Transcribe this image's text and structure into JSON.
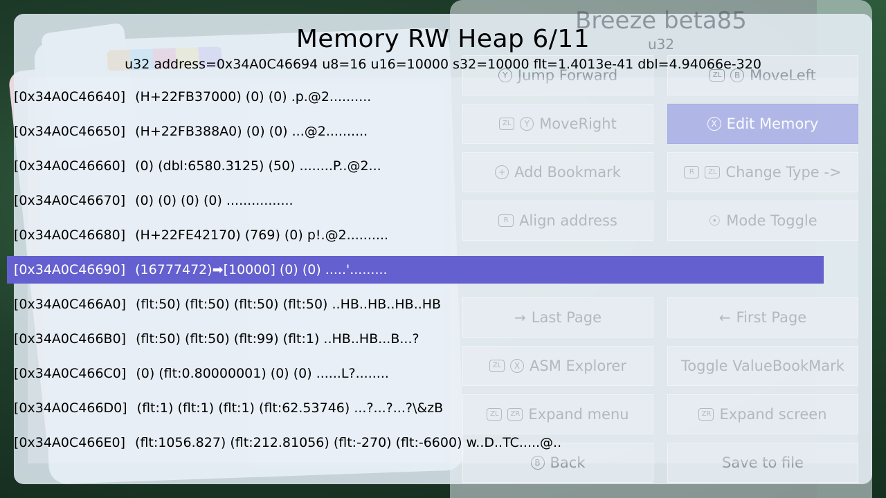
{
  "header": {
    "title": "Memory RW Heap 6/11",
    "subtitle": "u32 address=0x34A0C46694 u8=16 u16=10000 s32=10000 flt=1.4013e-41 dbl=4.94066e-320"
  },
  "menu": {
    "title": "Breeze beta85",
    "subtitle": "u32",
    "buttons": [
      {
        "label": "Jump Forward",
        "icons": [
          "Y"
        ],
        "active": false
      },
      {
        "label": "MoveLeft",
        "icons": [
          "ZL",
          "B"
        ],
        "active": false
      },
      {
        "label": "MoveRight",
        "icons": [
          "ZL",
          "Y"
        ],
        "active": false
      },
      {
        "label": "Edit Memory",
        "icons": [
          "X"
        ],
        "active": true
      },
      {
        "label": "Add Bookmark",
        "icons": [
          "+"
        ],
        "active": false
      },
      {
        "label": "Change Type ->",
        "icons": [
          "R",
          "ZL"
        ],
        "active": false
      },
      {
        "label": "Align address",
        "icons": [
          "R"
        ],
        "active": false
      },
      {
        "label": "Mode Toggle",
        "icons": [
          "stick"
        ],
        "active": false
      },
      {
        "label": "Last Page",
        "icons": [
          "arrow-right"
        ],
        "active": false
      },
      {
        "label": "First Page",
        "icons": [
          "arrow-left"
        ],
        "active": false
      },
      {
        "label": "ASM Explorer",
        "icons": [
          "ZL",
          "X"
        ],
        "active": false
      },
      {
        "label": "Toggle ValueBookMark",
        "icons": [],
        "active": false
      },
      {
        "label": "Expand menu",
        "icons": [
          "ZL",
          "ZR"
        ],
        "active": false
      },
      {
        "label": "Expand screen",
        "icons": [
          "ZR"
        ],
        "active": false
      },
      {
        "label": "Back",
        "icons": [
          "B"
        ],
        "active": false
      },
      {
        "label": "Save to file",
        "icons": [],
        "active": false
      }
    ]
  },
  "rows": [
    {
      "address": "[0x34A0C46640]",
      "content": "(H+22FB37000) (0) (0) .p.@2..........",
      "selected": false
    },
    {
      "address": "[0x34A0C46650]",
      "content": "(H+22FB388A0) (0) (0) ...@2..........",
      "selected": false
    },
    {
      "address": "[0x34A0C46660]",
      "content": "(0) (dbl:6580.3125) (50) ........P..@2...",
      "selected": false
    },
    {
      "address": "[0x34A0C46670]",
      "content": "(0) (0) (0) (0) ................",
      "selected": false
    },
    {
      "address": "[0x34A0C46680]",
      "content": "(H+22FE42170) (769) (0) p!.@2..........",
      "selected": false
    },
    {
      "address": "[0x34A0C46690]",
      "content": "(16777472)➡[10000] (0) (0) .....'.........",
      "selected": true
    },
    {
      "address": "[0x34A0C466A0]",
      "content": "(flt:50) (flt:50) (flt:50) (flt:50) ..HB..HB..HB..HB",
      "selected": false
    },
    {
      "address": "[0x34A0C466B0]",
      "content": "(flt:50) (flt:50) (flt:99) (flt:1) ..HB..HB...B...?",
      "selected": false
    },
    {
      "address": "[0x34A0C466C0]",
      "content": "(0) (flt:0.80000001) (0) (0) ......L?........",
      "selected": false
    },
    {
      "address": "[0x34A0C466D0]",
      "content": "(flt:1) (flt:1) (flt:1) (flt:62.53746) ...?...?...?\\&zB",
      "selected": false
    },
    {
      "address": "[0x34A0C466E0]",
      "content": "(flt:1056.827) (flt:212.81056) (flt:-270) (flt:-6600) w..D..TC.....@..",
      "selected": false
    }
  ],
  "colors": {
    "selected_row": "#6560cf",
    "active_button": "#7c84dc"
  }
}
